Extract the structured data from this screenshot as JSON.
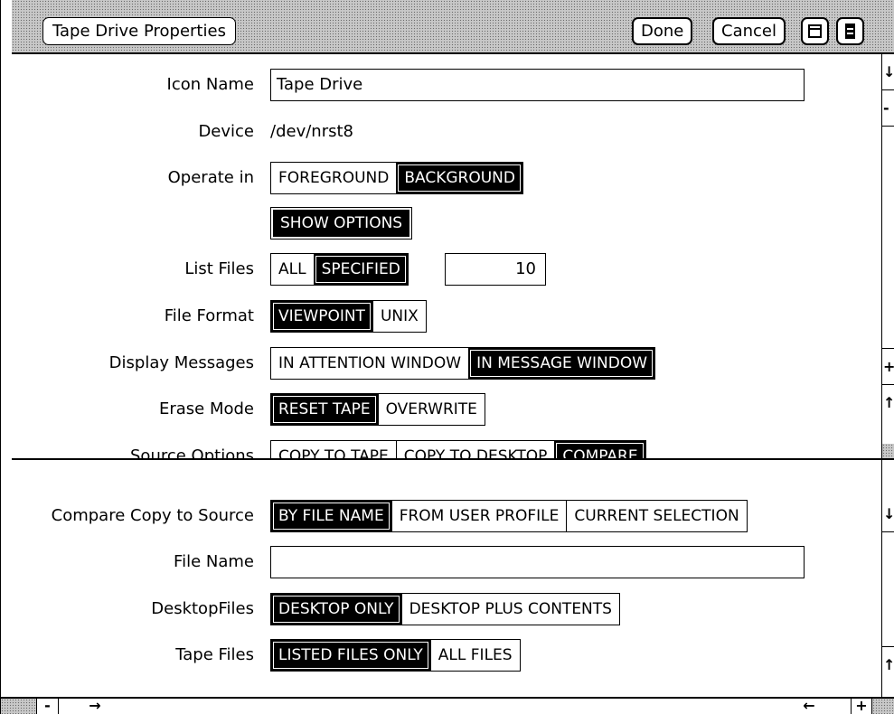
{
  "window": {
    "title": "Tape Drive Properties",
    "done_label": "Done",
    "cancel_label": "Cancel",
    "window_icon": "window-icon",
    "menu_icon": "menu-icon"
  },
  "props": {
    "icon_name": {
      "label": "Icon Name",
      "value": "Tape Drive"
    },
    "device": {
      "label": "Device",
      "value": "/dev/nrst8"
    },
    "operate_in": {
      "label": "Operate in",
      "options": [
        "FOREGROUND",
        "BACKGROUND"
      ],
      "selected": "BACKGROUND"
    },
    "show_options": {
      "label": "SHOW OPTIONS"
    },
    "list_files": {
      "label": "List Files",
      "options": [
        "ALL",
        "SPECIFIED"
      ],
      "selected": "SPECIFIED",
      "count": "10"
    },
    "file_format": {
      "label": "File Format",
      "options": [
        "VIEWPOINT",
        "UNIX"
      ],
      "selected": "VIEWPOINT"
    },
    "display_messages": {
      "label": "Display Messages",
      "options": [
        "IN ATTENTION WINDOW",
        "IN MESSAGE WINDOW"
      ],
      "selected": "IN MESSAGE WINDOW"
    },
    "erase_mode": {
      "label": "Erase Mode",
      "options": [
        "RESET TAPE",
        "OVERWRITE"
      ],
      "selected": "RESET TAPE"
    },
    "source_options": {
      "label": "Source Options",
      "options": [
        "COPY TO TAPE",
        "COPY TO DESKTOP",
        "COMPARE"
      ],
      "selected": "COMPARE"
    }
  },
  "compare": {
    "compare_copy": {
      "label": "Compare Copy to Source",
      "options": [
        "BY FILE NAME",
        "FROM USER PROFILE",
        "CURRENT SELECTION"
      ],
      "selected": "BY FILE NAME"
    },
    "file_name": {
      "label": "File Name",
      "value": ""
    },
    "desktop_files": {
      "label": "DesktopFiles",
      "options": [
        "DESKTOP ONLY",
        "DESKTOP PLUS CONTENTS"
      ],
      "selected": "DESKTOP ONLY"
    },
    "tape_files": {
      "label": "Tape Files",
      "options": [
        "LISTED FILES ONLY",
        "ALL FILES"
      ],
      "selected": "LISTED FILES ONLY"
    }
  },
  "scroll": {
    "down_arrow": "↓",
    "up_arrow": "↑",
    "right_arrow": "→",
    "left_arrow": "←",
    "minus": "-",
    "plus": "+"
  }
}
